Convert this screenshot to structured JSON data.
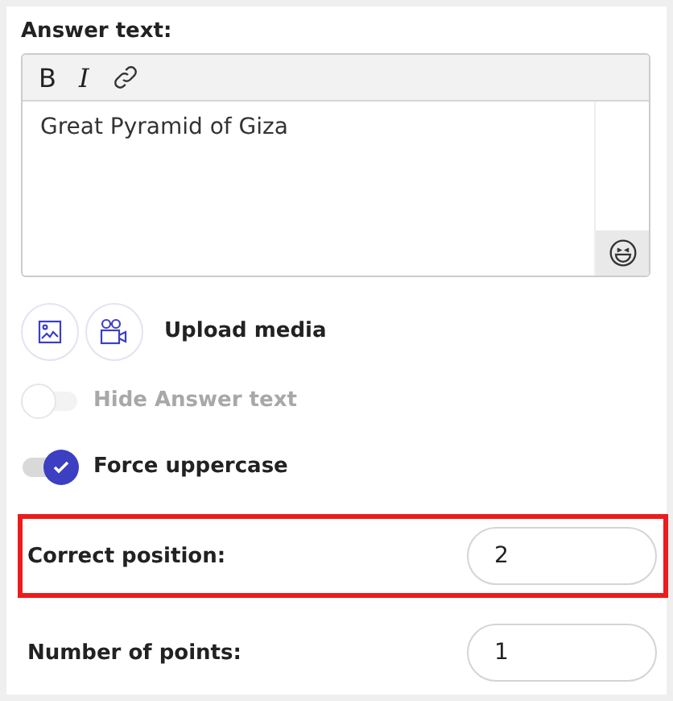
{
  "answer_text": {
    "label": "Answer text:",
    "toolbar": [
      "B",
      "I"
    ],
    "value": "Great Pyramid of Giza"
  },
  "upload": {
    "label": "Upload media"
  },
  "toggles": [
    {
      "label": "Hide Answer text",
      "on": false,
      "disabled": true
    },
    {
      "label": "Force uppercase",
      "on": true,
      "disabled": false
    }
  ],
  "fields": [
    {
      "label": "Correct position:",
      "value": "2",
      "highlighted": true
    },
    {
      "label": "Number of points:",
      "value": "1",
      "highlighted": false
    }
  ]
}
